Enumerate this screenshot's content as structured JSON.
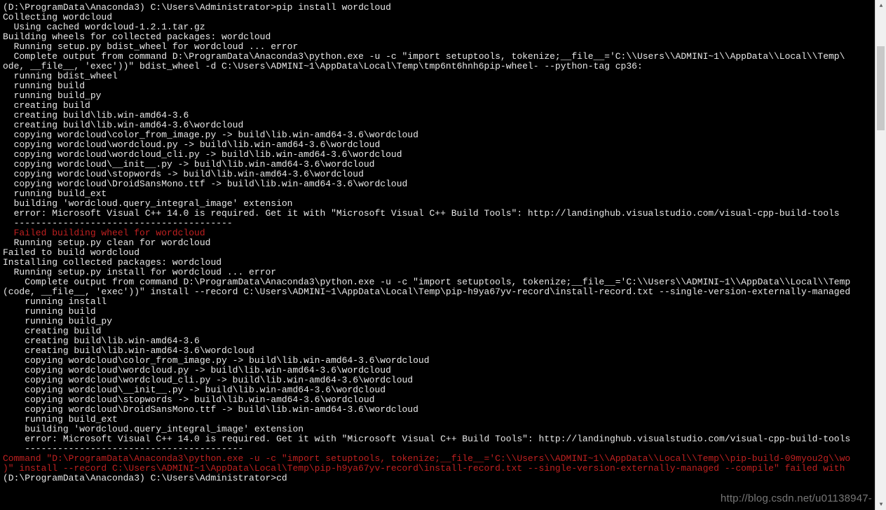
{
  "watermark": "http://blog.csdn.net/u01138947-",
  "scrollbar": {
    "up_glyph": "▲",
    "down_glyph": "▼"
  },
  "lines": [
    {
      "t": "(D:\\ProgramData\\Anaconda3) C:\\Users\\Administrator>pip install wordcloud",
      "c": "w"
    },
    {
      "t": "Collecting wordcloud",
      "c": "w"
    },
    {
      "t": "  Using cached wordcloud-1.2.1.tar.gz",
      "c": "w"
    },
    {
      "t": "Building wheels for collected packages: wordcloud",
      "c": "w"
    },
    {
      "t": "  Running setup.py bdist_wheel for wordcloud ... error",
      "c": "w"
    },
    {
      "t": "  Complete output from command D:\\ProgramData\\Anaconda3\\python.exe -u -c \"import setuptools, tokenize;__file__='C:\\\\Users\\\\ADMINI~1\\\\AppData\\\\Local\\\\Temp\\",
      "c": "w"
    },
    {
      "t": "ode, __file__, 'exec'))\" bdist_wheel -d C:\\Users\\ADMINI~1\\AppData\\Local\\Temp\\tmp6nt6hnh6pip-wheel- --python-tag cp36:",
      "c": "w"
    },
    {
      "t": "  running bdist_wheel",
      "c": "w"
    },
    {
      "t": "  running build",
      "c": "w"
    },
    {
      "t": "  running build_py",
      "c": "w"
    },
    {
      "t": "  creating build",
      "c": "w"
    },
    {
      "t": "  creating build\\lib.win-amd64-3.6",
      "c": "w"
    },
    {
      "t": "  creating build\\lib.win-amd64-3.6\\wordcloud",
      "c": "w"
    },
    {
      "t": "  copying wordcloud\\color_from_image.py -> build\\lib.win-amd64-3.6\\wordcloud",
      "c": "w"
    },
    {
      "t": "  copying wordcloud\\wordcloud.py -> build\\lib.win-amd64-3.6\\wordcloud",
      "c": "w"
    },
    {
      "t": "  copying wordcloud\\wordcloud_cli.py -> build\\lib.win-amd64-3.6\\wordcloud",
      "c": "w"
    },
    {
      "t": "  copying wordcloud\\__init__.py -> build\\lib.win-amd64-3.6\\wordcloud",
      "c": "w"
    },
    {
      "t": "  copying wordcloud\\stopwords -> build\\lib.win-amd64-3.6\\wordcloud",
      "c": "w"
    },
    {
      "t": "  copying wordcloud\\DroidSansMono.ttf -> build\\lib.win-amd64-3.6\\wordcloud",
      "c": "w"
    },
    {
      "t": "  running build_ext",
      "c": "w"
    },
    {
      "t": "  building 'wordcloud.query_integral_image' extension",
      "c": "w"
    },
    {
      "t": "  error: Microsoft Visual C++ 14.0 is required. Get it with \"Microsoft Visual C++ Build Tools\": http://landinghub.visualstudio.com/visual-cpp-build-tools",
      "c": "w"
    },
    {
      "t": "",
      "c": "w"
    },
    {
      "t": "  ----------------------------------------",
      "c": "w"
    },
    {
      "t": "  Failed building wheel for wordcloud",
      "c": "r"
    },
    {
      "t": "  Running setup.py clean for wordcloud",
      "c": "w"
    },
    {
      "t": "Failed to build wordcloud",
      "c": "w"
    },
    {
      "t": "Installing collected packages: wordcloud",
      "c": "w"
    },
    {
      "t": "  Running setup.py install for wordcloud ... error",
      "c": "w"
    },
    {
      "t": "    Complete output from command D:\\ProgramData\\Anaconda3\\python.exe -u -c \"import setuptools, tokenize;__file__='C:\\\\Users\\\\ADMINI~1\\\\AppData\\\\Local\\\\Temp",
      "c": "w"
    },
    {
      "t": "(code, __file__, 'exec'))\" install --record C:\\Users\\ADMINI~1\\AppData\\Local\\Temp\\pip-h9ya67yv-record\\install-record.txt --single-version-externally-managed",
      "c": "w"
    },
    {
      "t": "    running install",
      "c": "w"
    },
    {
      "t": "    running build",
      "c": "w"
    },
    {
      "t": "    running build_py",
      "c": "w"
    },
    {
      "t": "    creating build",
      "c": "w"
    },
    {
      "t": "    creating build\\lib.win-amd64-3.6",
      "c": "w"
    },
    {
      "t": "    creating build\\lib.win-amd64-3.6\\wordcloud",
      "c": "w"
    },
    {
      "t": "    copying wordcloud\\color_from_image.py -> build\\lib.win-amd64-3.6\\wordcloud",
      "c": "w"
    },
    {
      "t": "    copying wordcloud\\wordcloud.py -> build\\lib.win-amd64-3.6\\wordcloud",
      "c": "w"
    },
    {
      "t": "    copying wordcloud\\wordcloud_cli.py -> build\\lib.win-amd64-3.6\\wordcloud",
      "c": "w"
    },
    {
      "t": "    copying wordcloud\\__init__.py -> build\\lib.win-amd64-3.6\\wordcloud",
      "c": "w"
    },
    {
      "t": "    copying wordcloud\\stopwords -> build\\lib.win-amd64-3.6\\wordcloud",
      "c": "w"
    },
    {
      "t": "    copying wordcloud\\DroidSansMono.ttf -> build\\lib.win-amd64-3.6\\wordcloud",
      "c": "w"
    },
    {
      "t": "    running build_ext",
      "c": "w"
    },
    {
      "t": "    building 'wordcloud.query_integral_image' extension",
      "c": "w"
    },
    {
      "t": "    error: Microsoft Visual C++ 14.0 is required. Get it with \"Microsoft Visual C++ Build Tools\": http://landinghub.visualstudio.com/visual-cpp-build-tools",
      "c": "w"
    },
    {
      "t": "",
      "c": "w"
    },
    {
      "t": "    ----------------------------------------",
      "c": "w"
    },
    {
      "t": "Command \"D:\\ProgramData\\Anaconda3\\python.exe -u -c \"import setuptools, tokenize;__file__='C:\\\\Users\\\\ADMINI~1\\\\AppData\\\\Local\\\\Temp\\\\pip-build-09myou2g\\\\wo",
      "c": "r"
    },
    {
      "t": ")\" install --record C:\\Users\\ADMINI~1\\AppData\\Local\\Temp\\pip-h9ya67yv-record\\install-record.txt --single-version-externally-managed --compile\" failed with",
      "c": "r"
    },
    {
      "t": "",
      "c": "w"
    },
    {
      "t": "(D:\\ProgramData\\Anaconda3) C:\\Users\\Administrator>cd",
      "c": "w"
    }
  ]
}
